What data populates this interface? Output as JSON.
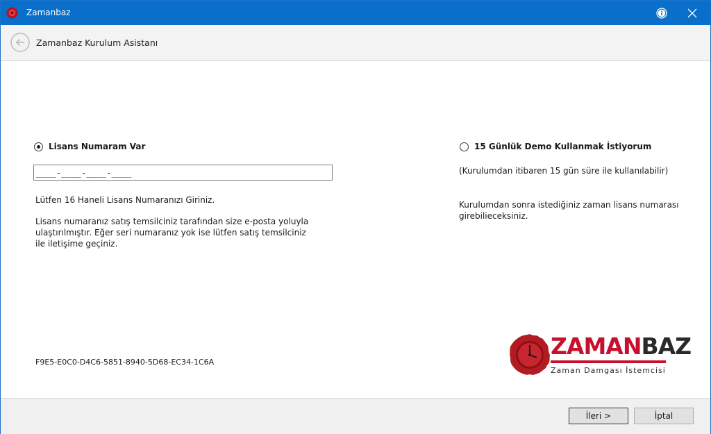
{
  "window": {
    "title": "Zamanbaz",
    "colors": {
      "titlebar": "#0a6fcb",
      "accent": "#c8102e"
    }
  },
  "header": {
    "title": "Zamanbaz Kurulum Asistanı"
  },
  "license_option": {
    "label": "Lisans Numaram Var",
    "selected": true,
    "input_value": "____-____-____-____",
    "instruction": "Lütfen 16 Haneli Lisans Numaranızı Giriniz.",
    "note_line1": "Lisans numaranız satış temsilciniz tarafından size e-posta yoluyla",
    "note_line2": "ulaştırılmıştır. Eğer seri numaranız yok ise lütfen satış temsilciniz",
    "note_line3": "ile iletişime geçiniz."
  },
  "demo_option": {
    "label": "15 Günlük Demo Kullanmak İstiyorum",
    "selected": false,
    "subtitle": "(Kurulumdan itibaren 15 gün süre ile kullanılabilir)",
    "note_line1": "Kurulumdan sonra istediğiniz zaman lisans numarası",
    "note_line2": "girebilieceksiniz."
  },
  "machine_id": "F9E5-E0C0-D4C6-5851-8940-5D68-EC34-1C6A",
  "logo": {
    "name_part1": "ZAMAN",
    "name_part2": "BAZ",
    "tagline": "Zaman Damgası İstemcisi"
  },
  "footer": {
    "next_label": "İleri >",
    "cancel_label": "İptal"
  }
}
